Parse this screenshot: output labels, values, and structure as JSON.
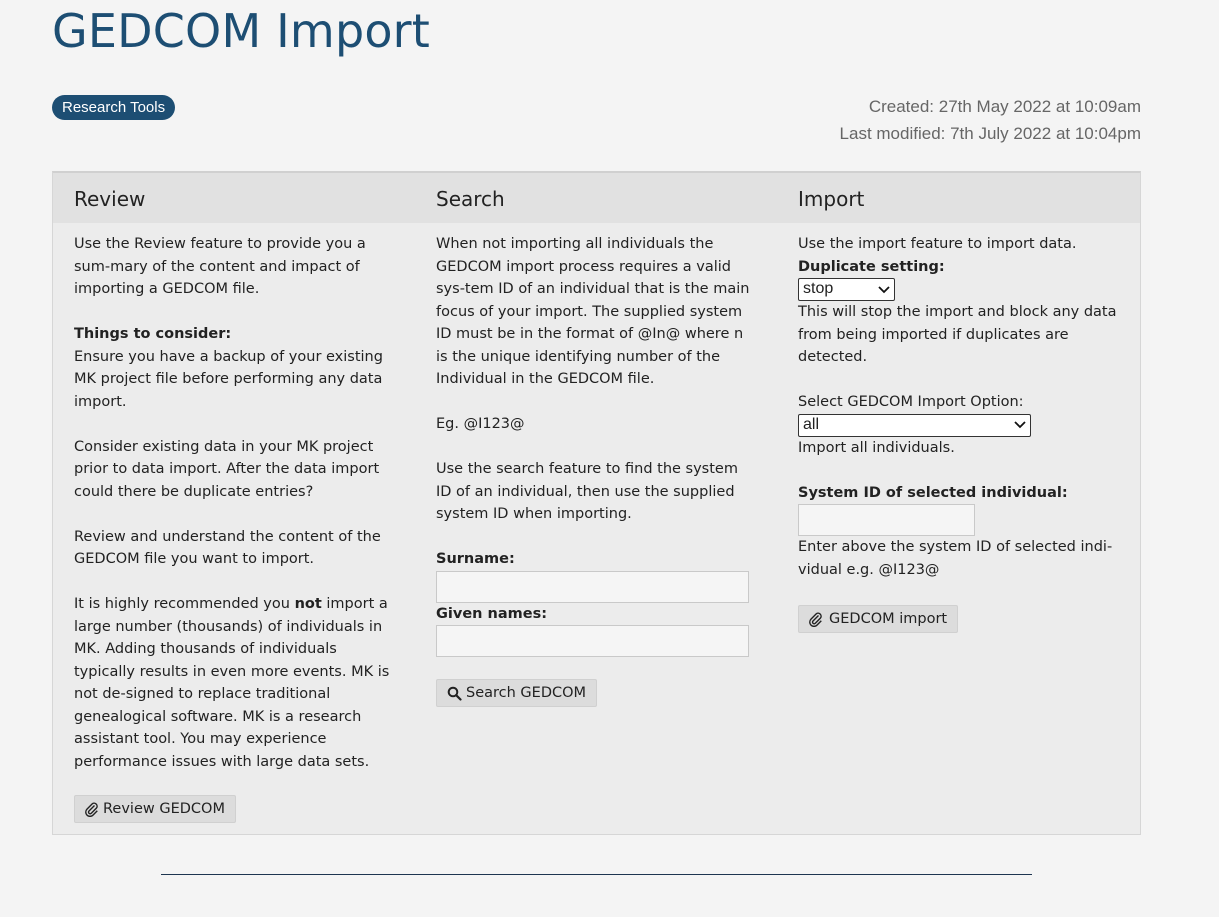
{
  "page": {
    "title": "GEDCOM Import",
    "tag": "Research Tools",
    "created": "Created: 27th May 2022 at 10:09am",
    "modified": "Last modified: 7th July 2022 at 10:04pm"
  },
  "review": {
    "title": "Review",
    "intro": "Use the Review feature to provide you a sum-mary of the content and impact of importing a GEDCOM file.",
    "things_heading": "Things to consider:",
    "things_1": "Ensure you have a backup of your existing MK project file before performing any data import.",
    "things_2": "Consider existing data in your MK project prior to data import. After the data import could there be duplicate entries?",
    "things_3": "Review and understand the content of the GEDCOM file you want to import.",
    "rec_before": "It is highly recommended you ",
    "rec_not": "not",
    "rec_after": " import a large number (thousands) of individuals in MK. Adding thousands of individuals typically results in even more events. MK is not de-signed to replace traditional genealogical software. MK is a research assistant tool. You may experience performance issues with large data sets.",
    "button": "Review GEDCOM"
  },
  "search": {
    "title": "Search",
    "intro": "When not importing all individuals the GEDCOM import process requires a valid sys-tem ID of an individual that is the main focus of your import. The supplied system ID must be in the format of @In@ where n is the unique identifying number of the Individual in the GEDCOM file.",
    "example": "Eg. @I123@",
    "usage": "Use the search feature to find the system ID of an individual, then use the supplied system ID when importing.",
    "surname_label": "Surname:",
    "surname_value": "",
    "given_label": "Given names:",
    "given_value": "",
    "button": "Search GEDCOM"
  },
  "import": {
    "title": "Import",
    "intro": "Use the import feature to import data.",
    "dup_label": "Duplicate setting:",
    "dup_selected": "stop",
    "dup_help": "This will stop the import and block any data from being imported if duplicates are detected.",
    "option_label": "Select GEDCOM Import Option:",
    "option_selected": "all",
    "option_help": "Import all individuals.",
    "sysid_label": "System ID of selected individual:",
    "sysid_value": "",
    "sysid_help": "Enter above the system ID of selected indi-vidual e.g. @I123@",
    "button": "GEDCOM import"
  },
  "icons": {
    "review_button_icon": "paperclip-icon",
    "search_button_icon": "magnifier-icon",
    "import_button_icon": "paperclip-icon"
  }
}
